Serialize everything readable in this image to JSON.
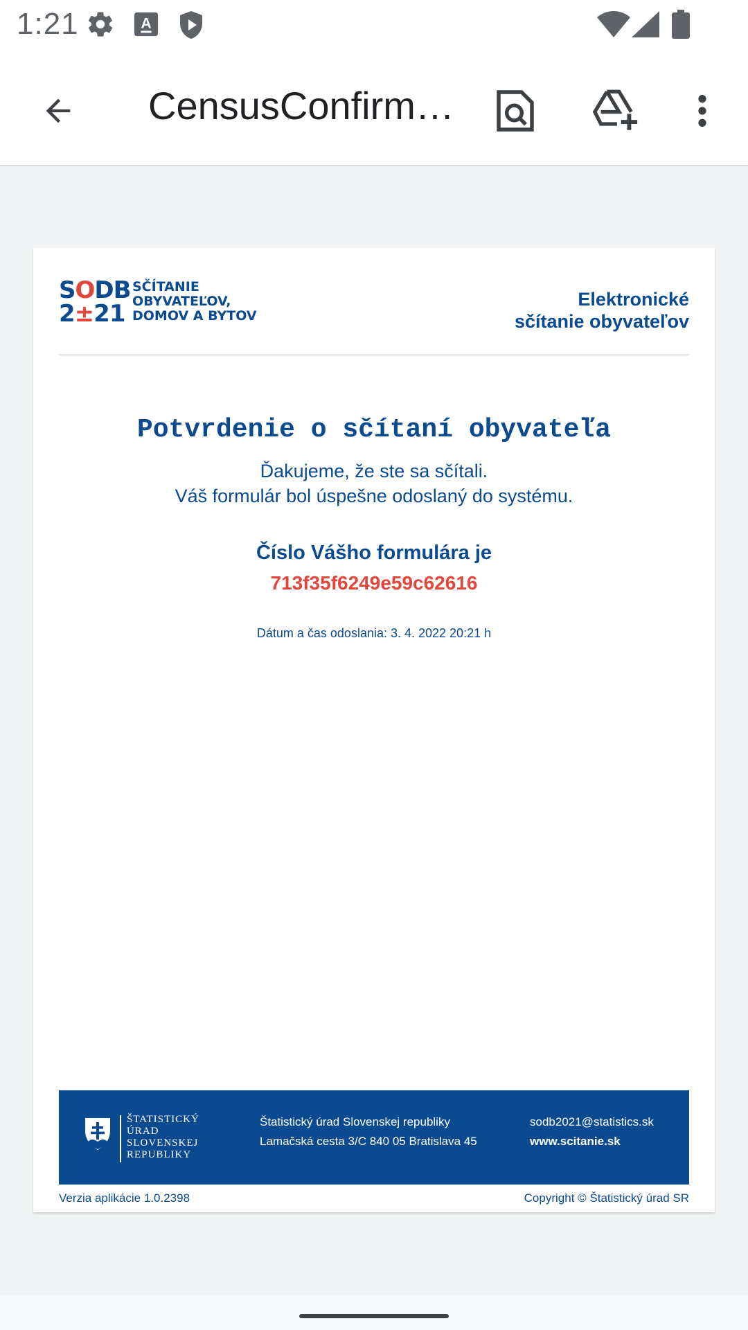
{
  "status_bar": {
    "time": "1:21",
    "icons": [
      "settings-icon",
      "keyboard-a-icon",
      "shield-play-icon",
      "wifi-icon",
      "cell-signal-icon",
      "battery-icon"
    ]
  },
  "app_bar": {
    "title": "CensusConfirm…",
    "actions": [
      "back-arrow-icon",
      "search-document-icon",
      "add-to-drive-icon",
      "more-vert-icon"
    ]
  },
  "document": {
    "logo": {
      "nums_line1_a": "S",
      "nums_line1_b": "O",
      "nums_line1_c": "DB",
      "nums_line2_a": "2",
      "nums_line2_b": "±",
      "nums_line2_c": "21",
      "text_line1": "SČÍTANIE",
      "text_line2": "OBYVATEĽOV,",
      "text_line3": "DOMOV A BYTOV"
    },
    "header_right_line1": "Elektronické",
    "header_right_line2": "sčítanie obyvateľov",
    "heading": "Potvrdenie o sčítaní obyvateľa",
    "thanks_line1": "Ďakujeme, že ste sa sčítali.",
    "thanks_line2": "Váš formulár bol úspešne odoslaný do systému.",
    "form_label": "Číslo Vášho formulára je",
    "form_id": "713f35f6249e59c62616",
    "sent_date": "Dátum a čas odoslania: 3. 4. 2022 20:21 h",
    "footer": {
      "office_line1": "ŠTATISTICKÝ",
      "office_line2": "ÚRAD",
      "office_line3": "SLOVENSKEJ",
      "office_line4": "REPUBLIKY",
      "address_line1": "Štatistický úrad Slovenskej republiky",
      "address_line2": "Lamačská cesta 3/C 840 05 Bratislava 45",
      "email": "sodb2021@statistics.sk",
      "website": "www.scitanie.sk"
    },
    "version": "Verzia aplikácie 1.0.2398",
    "copyright": "Copyright © Štatistický úrad SR"
  },
  "colors": {
    "brand_blue": "#0b4a8f",
    "accent_red": "#e1463a"
  }
}
